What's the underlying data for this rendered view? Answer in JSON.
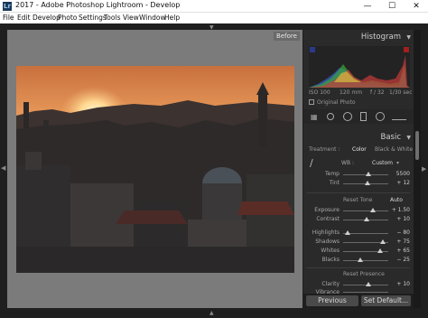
{
  "window": {
    "title": "2017 - Adobe Photoshop Lightroom - Develop",
    "icon_label": "Lr",
    "minimize_icon": "minimize-icon",
    "maximize_icon": "maximize-icon",
    "close_icon": "close-icon"
  },
  "menu": [
    "File",
    "Edit",
    "Develop",
    "Photo",
    "Settings",
    "Tools",
    "View",
    "Window",
    "Help"
  ],
  "view": {
    "before_label": "Before"
  },
  "histogram": {
    "title": "Histogram",
    "iso": "ISO 100",
    "focal": "120 mm",
    "aperture": "f / 32",
    "shutter": "1/30 sec",
    "original_photo": "Original Photo"
  },
  "basic": {
    "title": "Basic",
    "treatment_label": "Treatment :",
    "color_label": "Color",
    "bw_label": "Black & White",
    "wb_label": "WB :",
    "wb_value": "Custom",
    "temp_label": "Temp",
    "temp_value": "5500",
    "tint_label": "Tint",
    "tint_value": "+ 12",
    "reset_tone": "Reset Tone",
    "auto_label": "Auto",
    "exposure_label": "Exposure",
    "exposure_value": "+ 1.50",
    "contrast_label": "Contrast",
    "contrast_value": "+ 10",
    "highlights_label": "Highlights",
    "highlights_value": "− 80",
    "shadows_label": "Shadows",
    "shadows_value": "+ 75",
    "whites_label": "Whites",
    "whites_value": "+ 65",
    "blacks_label": "Blacks",
    "blacks_value": "− 25",
    "reset_presence": "Reset Presence",
    "clarity_label": "Clarity",
    "clarity_value": "+ 10",
    "vibrance_label": "Vibrance"
  },
  "buttons": {
    "previous": "Previous",
    "set_default": "Set Default..."
  },
  "slider_levels": {
    "temp": 0.55,
    "tint": 0.53,
    "exposure": 0.65,
    "contrast": 0.52,
    "highlights": 0.1,
    "shadows": 0.87,
    "whites": 0.82,
    "blacks": 0.38,
    "clarity": 0.55,
    "vibrance": 0.5
  },
  "colors": {
    "accent": "#3a6ea5",
    "panel": "#2a2a2a",
    "canvas": "#7b7b7b"
  }
}
